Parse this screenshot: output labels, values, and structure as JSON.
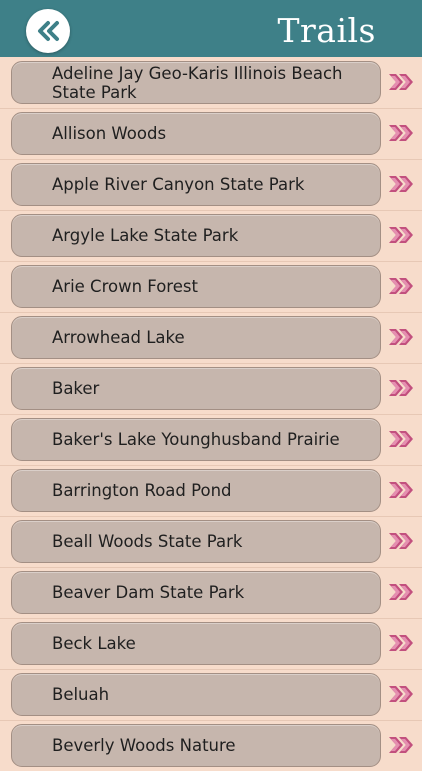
{
  "header": {
    "title": "Trails",
    "back_icon": "double-chevron-left-icon",
    "bar_color": "#3e8088"
  },
  "list": {
    "arrow_icon": "double-chevron-right-icon",
    "arrow_color": "#c2507e",
    "items": [
      {
        "label": "Adeline Jay Geo-Karis Illinois Beach State Park"
      },
      {
        "label": "Allison Woods"
      },
      {
        "label": "Apple River Canyon State Park"
      },
      {
        "label": "Argyle Lake State Park"
      },
      {
        "label": "Arie Crown Forest"
      },
      {
        "label": "Arrowhead Lake"
      },
      {
        "label": "Baker"
      },
      {
        "label": "Baker's Lake Younghusband Prairie"
      },
      {
        "label": "Barrington Road Pond"
      },
      {
        "label": "Beall Woods State Park"
      },
      {
        "label": "Beaver Dam State Park"
      },
      {
        "label": "Beck Lake"
      },
      {
        "label": "Beluah"
      },
      {
        "label": "Beverly Woods Nature"
      }
    ]
  }
}
